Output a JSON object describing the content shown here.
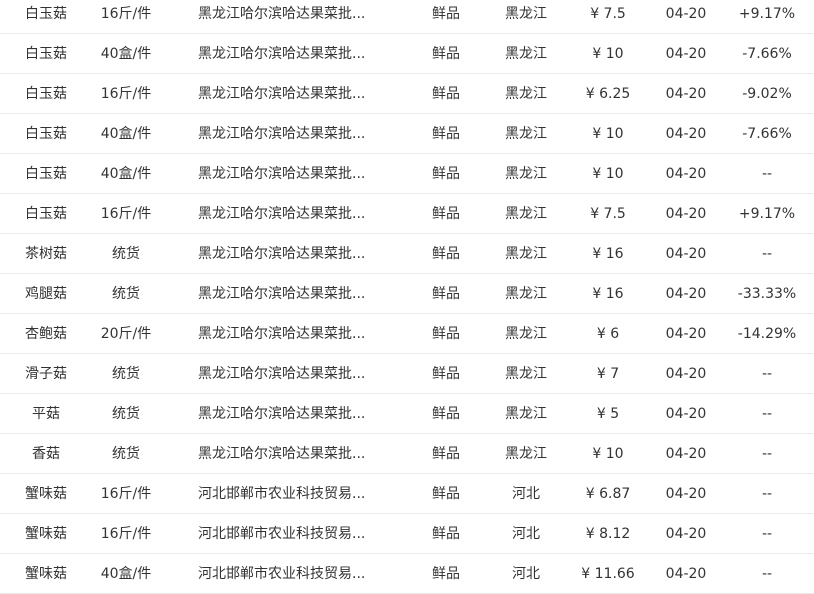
{
  "rows": [
    {
      "name": "白玉菇",
      "spec": "16斤/件",
      "market": "黑龙江哈尔滨哈达果菜批...",
      "type": "鲜品",
      "region": "黑龙江",
      "price": "¥ 7.5",
      "date": "04-20",
      "change": "+9.17%"
    },
    {
      "name": "白玉菇",
      "spec": "40盒/件",
      "market": "黑龙江哈尔滨哈达果菜批...",
      "type": "鲜品",
      "region": "黑龙江",
      "price": "¥ 10",
      "date": "04-20",
      "change": "-7.66%"
    },
    {
      "name": "白玉菇",
      "spec": "16斤/件",
      "market": "黑龙江哈尔滨哈达果菜批...",
      "type": "鲜品",
      "region": "黑龙江",
      "price": "¥ 6.25",
      "date": "04-20",
      "change": "-9.02%"
    },
    {
      "name": "白玉菇",
      "spec": "40盒/件",
      "market": "黑龙江哈尔滨哈达果菜批...",
      "type": "鲜品",
      "region": "黑龙江",
      "price": "¥ 10",
      "date": "04-20",
      "change": "-7.66%"
    },
    {
      "name": "白玉菇",
      "spec": "40盒/件",
      "market": "黑龙江哈尔滨哈达果菜批...",
      "type": "鲜品",
      "region": "黑龙江",
      "price": "¥ 10",
      "date": "04-20",
      "change": "--"
    },
    {
      "name": "白玉菇",
      "spec": "16斤/件",
      "market": "黑龙江哈尔滨哈达果菜批...",
      "type": "鲜品",
      "region": "黑龙江",
      "price": "¥ 7.5",
      "date": "04-20",
      "change": "+9.17%"
    },
    {
      "name": "茶树菇",
      "spec": "统货",
      "market": "黑龙江哈尔滨哈达果菜批...",
      "type": "鲜品",
      "region": "黑龙江",
      "price": "¥ 16",
      "date": "04-20",
      "change": "--"
    },
    {
      "name": "鸡腿菇",
      "spec": "统货",
      "market": "黑龙江哈尔滨哈达果菜批...",
      "type": "鲜品",
      "region": "黑龙江",
      "price": "¥ 16",
      "date": "04-20",
      "change": "-33.33%"
    },
    {
      "name": "杏鲍菇",
      "spec": "20斤/件",
      "market": "黑龙江哈尔滨哈达果菜批...",
      "type": "鲜品",
      "region": "黑龙江",
      "price": "¥ 6",
      "date": "04-20",
      "change": "-14.29%"
    },
    {
      "name": "滑子菇",
      "spec": "统货",
      "market": "黑龙江哈尔滨哈达果菜批...",
      "type": "鲜品",
      "region": "黑龙江",
      "price": "¥ 7",
      "date": "04-20",
      "change": "--"
    },
    {
      "name": "平菇",
      "spec": "统货",
      "market": "黑龙江哈尔滨哈达果菜批...",
      "type": "鲜品",
      "region": "黑龙江",
      "price": "¥ 5",
      "date": "04-20",
      "change": "--"
    },
    {
      "name": "香菇",
      "spec": "统货",
      "market": "黑龙江哈尔滨哈达果菜批...",
      "type": "鲜品",
      "region": "黑龙江",
      "price": "¥ 10",
      "date": "04-20",
      "change": "--"
    },
    {
      "name": "蟹味菇",
      "spec": "16斤/件",
      "market": "河北邯郸市农业科技贸易...",
      "type": "鲜品",
      "region": "河北",
      "price": "¥ 6.87",
      "date": "04-20",
      "change": "--"
    },
    {
      "name": "蟹味菇",
      "spec": "16斤/件",
      "market": "河北邯郸市农业科技贸易...",
      "type": "鲜品",
      "region": "河北",
      "price": "¥ 8.12",
      "date": "04-20",
      "change": "--"
    },
    {
      "name": "蟹味菇",
      "spec": "40盒/件",
      "market": "河北邯郸市农业科技贸易...",
      "type": "鲜品",
      "region": "河北",
      "price": "¥ 11.66",
      "date": "04-20",
      "change": "--"
    }
  ]
}
